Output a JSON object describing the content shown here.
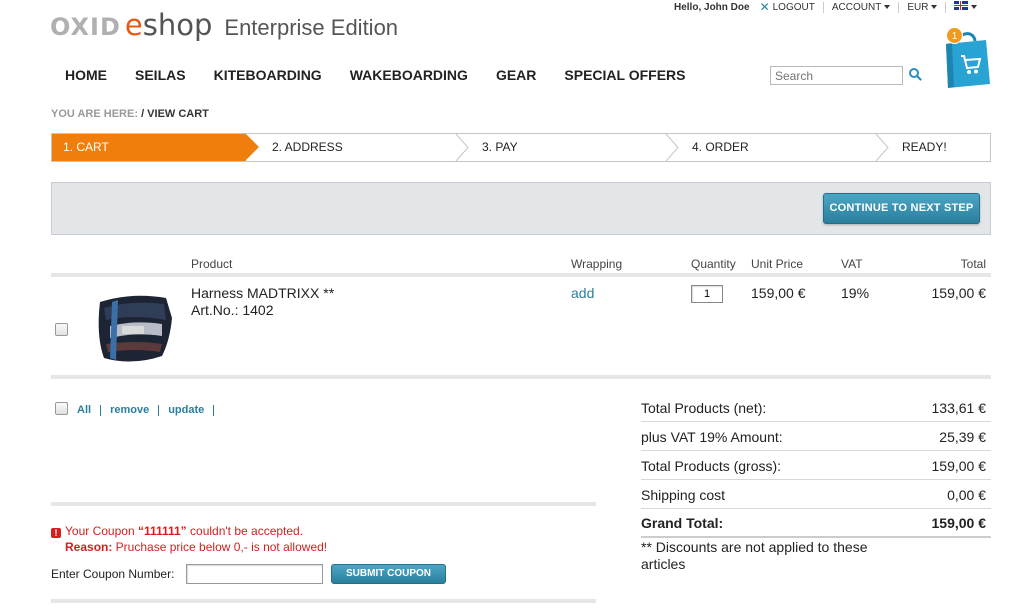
{
  "brand": {
    "logo_oxid": "OXID",
    "logo_e": "e",
    "logo_shop": "shop",
    "edition": "Enterprise Edition"
  },
  "topbar": {
    "greeting": "Hello, John Doe",
    "logout": "LOGOUT",
    "account": "ACCOUNT",
    "currency": "EUR",
    "language_flag": "uk-flag-icon"
  },
  "nav": [
    "HOME",
    "SEILAS",
    "KITEBOARDING",
    "WAKEBOARDING",
    "GEAR",
    "SPECIAL OFFERS"
  ],
  "search": {
    "placeholder": "Search"
  },
  "basket": {
    "count": "1"
  },
  "breadcrumb": {
    "prefix": "YOU ARE HERE:",
    "current": "/ VIEW CART"
  },
  "steps": [
    "1. CART",
    "2. ADDRESS",
    "3. PAY",
    "4. ORDER",
    "READY!"
  ],
  "continue_button": "CONTINUE TO NEXT STEP",
  "table": {
    "headers": {
      "product": "Product",
      "wrapping": "Wrapping",
      "quantity": "Quantity",
      "unit_price": "Unit Price",
      "vat": "VAT",
      "total": "Total"
    },
    "rows": [
      {
        "name": "Harness MADTRIXX **",
        "artno": "Art.No.: 1402",
        "wrapping": "add",
        "quantity": "1",
        "unit_price": "159,00 €",
        "vat": "19%",
        "total": "159,00 €"
      }
    ]
  },
  "list_actions": {
    "all": "All",
    "remove": "remove",
    "update": "update"
  },
  "totals": [
    {
      "label": "Total Products (net):",
      "value": "133,61 €"
    },
    {
      "label": "plus VAT 19% Amount:",
      "value": "25,39 €"
    },
    {
      "label": "Total Products (gross):",
      "value": "159,00 €"
    },
    {
      "label": "Shipping cost",
      "value": "0,00 €"
    },
    {
      "label": "Grand Total:",
      "value": "159,00 €"
    }
  ],
  "discount_note": "** Discounts are not applied to these articles",
  "coupon": {
    "error_prefix": "Your Coupon ",
    "error_code": "“111111”",
    "error_suffix": " couldn't be accepted.",
    "reason_label": "Reason:",
    "reason_text": " Pruchase price below 0,- is not allowed!",
    "label": "Enter Coupon Number:",
    "button": "SUBMIT COUPON"
  },
  "colors": {
    "accent_orange": "#f07e0c",
    "button_teal": "#2a7f9d",
    "error_red": "#d21f1f"
  }
}
